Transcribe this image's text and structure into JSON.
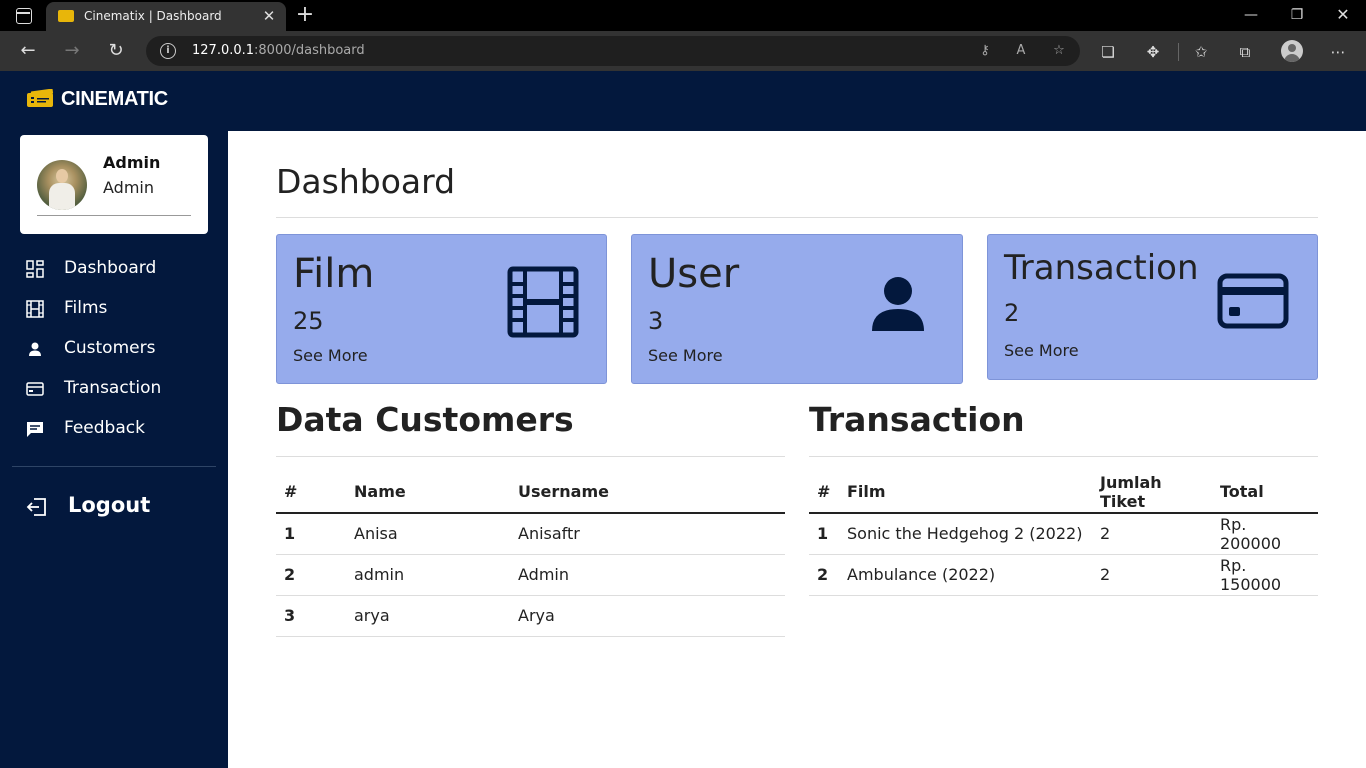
{
  "browser": {
    "tab_title": "Cinematix | Dashboard",
    "url_host": "127.0.0.1",
    "url_rest": ":8000/dashboard"
  },
  "app": {
    "logo_text": "CINEMATIC",
    "brand_color": "#03183d",
    "card_color": "#96abec"
  },
  "profile": {
    "name": "Admin",
    "role": "Admin"
  },
  "sidebar": {
    "items": [
      {
        "label": "Dashboard",
        "icon": "grid-icon"
      },
      {
        "label": "Films",
        "icon": "film-icon"
      },
      {
        "label": "Customers",
        "icon": "user-icon"
      },
      {
        "label": "Transaction",
        "icon": "card-icon"
      },
      {
        "label": "Feedback",
        "icon": "feedback-icon"
      }
    ],
    "logout_label": "Logout"
  },
  "page_title": "Dashboard",
  "stats": [
    {
      "title": "Film",
      "value": "25",
      "more": "See More",
      "icon": "film-icon"
    },
    {
      "title": "User",
      "value": "3",
      "more": "See More",
      "icon": "user-icon"
    },
    {
      "title": "Transaction",
      "value": "2",
      "more": "See More",
      "icon": "credit-card-icon"
    }
  ],
  "customers": {
    "title": "Data Customers",
    "headers": [
      "#",
      "Name",
      "Username"
    ],
    "rows": [
      [
        "1",
        "Anisa",
        "Anisaftr"
      ],
      [
        "2",
        "admin",
        "Admin"
      ],
      [
        "3",
        "arya",
        "Arya"
      ]
    ]
  },
  "transactions": {
    "title": "Transaction",
    "headers": [
      "#",
      "Film",
      "Jumlah Tiket",
      "Total"
    ],
    "rows": [
      [
        "1",
        "Sonic the Hedgehog 2 (2022)",
        "2",
        "Rp. 200000"
      ],
      [
        "2",
        "Ambulance (2022)",
        "2",
        "Rp. 150000"
      ]
    ]
  }
}
